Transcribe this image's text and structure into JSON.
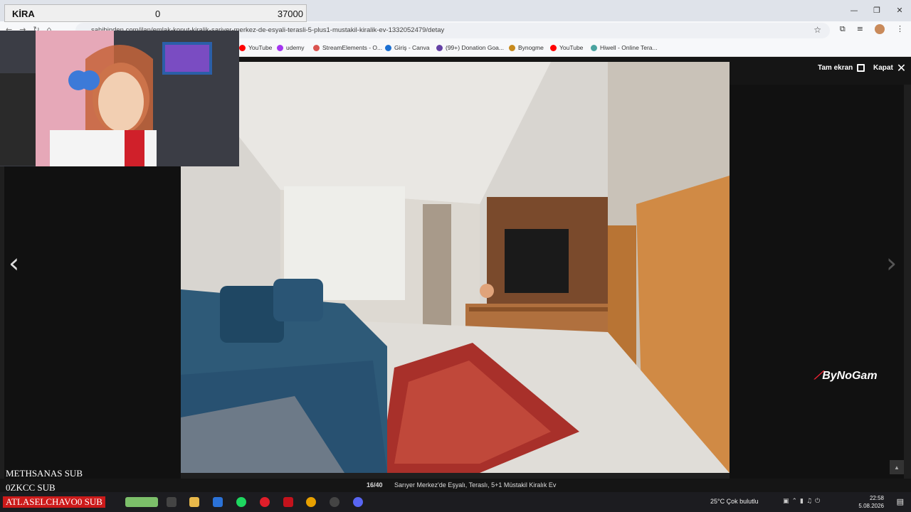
{
  "overlay": {
    "kira_label": "KİRA",
    "kira_min": "0",
    "kira_value": "37000",
    "brand_text": "ByNoGam",
    "subs": [
      "METHSANAS  SUB",
      "0ZKCC  SUB",
      "ATLASELCHAVO0  SUB"
    ]
  },
  "browser": {
    "url": "sahibinden.com/ilan/emlak-konut-kiralik-sariyer-merkez-de-esyali-terasli-5-plus1-mustakil-kiralik-ev-1332052479/detay",
    "bookmarks": [
      {
        "label": "YouTube",
        "color": "#ff0000"
      },
      {
        "label": "udemy",
        "color": "#a435f0"
      },
      {
        "label": "StreamElements - O...",
        "color": "#d9534f"
      },
      {
        "label": "Giriş - Canva",
        "color": "#1b6fd1"
      },
      {
        "label": "(99+) Donation Goa...",
        "color": "#6441a5"
      },
      {
        "label": "Bynogme",
        "color": "#c78a1d"
      },
      {
        "label": "YouTube",
        "color": "#ff0000"
      },
      {
        "label": "Hiwell - Online Tera...",
        "color": "#4aa3a0"
      }
    ]
  },
  "viewer": {
    "fullscreen_label": "Tam ekran",
    "close_label": "Kapat",
    "counter": "16/40",
    "caption": "Sarıyer Merkez'de Eşyalı, Teraslı, 5+1 Müstakil Kiralık Ev",
    "prev_icon": "chevron-left-icon",
    "next_icon": "chevron-right-icon"
  },
  "taskbar": {
    "weather": "25°C  Çok bulutlu",
    "time": "22:58",
    "date": "5.08.2026"
  }
}
